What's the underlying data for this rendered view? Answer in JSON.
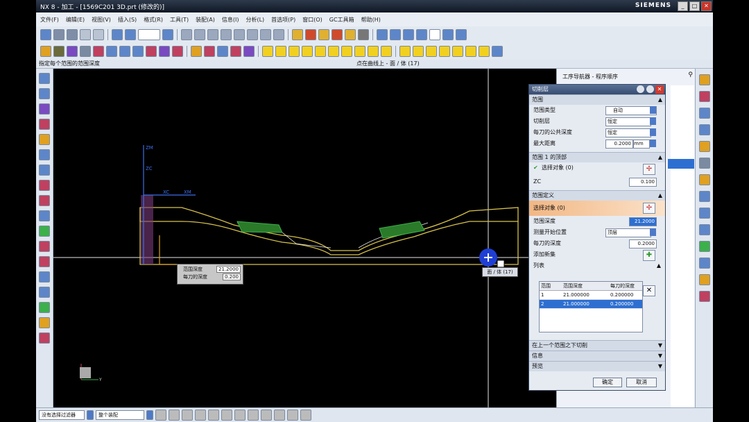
{
  "app": {
    "title": "NX 8 - 加工 - [1569C201 3D.prt (修改的)]",
    "brand": "SIEMENS"
  },
  "menu": [
    "文件(F)",
    "编辑(E)",
    "视图(V)",
    "插入(S)",
    "格式(R)",
    "工具(T)",
    "装配(A)",
    "信息(I)",
    "分析(L)",
    "首选项(P)",
    "窗口(O)",
    "GC工具箱",
    "帮助(H)"
  ],
  "hint": {
    "left": "指定每个范围的范围深度",
    "center": "点在曲线上 - 面 / 体 (17)"
  },
  "dialog": {
    "title": "切削层",
    "sec_main": "范围",
    "range_type_label": "范围类型",
    "range_type_value": "自动",
    "cut_layer_label": "切削层",
    "cut_layer_value": "恒定",
    "common_depth_label": "每刀的公共深度",
    "common_depth_value": "恒定",
    "max_dist_label": "最大距离",
    "max_dist_value": "0.2000",
    "max_dist_unit": "mm",
    "sec_range1": "范围 1 的顶部",
    "select_object_label": "选择对象 (0)",
    "zc_label": "ZC",
    "zc_value": "0.100",
    "sec_def": "范围定义",
    "select_object_label2": "选择对象 (0)",
    "range_depth_label": "范围深度",
    "range_depth_value": "21.2000",
    "measure_from_label": "测量开始位置",
    "measure_from_value": "顶层",
    "per_cut_depth_label": "每刀的深度",
    "per_cut_depth_value": "0.2000",
    "add_range_label": "添加新集",
    "list_label": "列表",
    "table_headers": [
      "范围",
      "范围深度",
      "每刀的深度"
    ],
    "table_rows": [
      [
        "1",
        "21.000000",
        "0.200000"
      ],
      [
        "2",
        "21.000000",
        "0.200000"
      ]
    ],
    "sec_between": "在上一个范围之下切削",
    "sec_preview": "信息",
    "sec_preview2": "预览",
    "ok": "确定",
    "cancel": "取消"
  },
  "navigator": {
    "title": "工序导航器 - 程序顺序"
  },
  "viewport_labels": {
    "zm": "ZM",
    "zc": "ZC",
    "xc": "XC",
    "xm": "XM",
    "xc2": "X",
    "yc": "Y"
  },
  "tooltip": {
    "depth_label": "范围深度",
    "depth_value": "21.2000",
    "per_cut_label": "每刀的深度",
    "per_cut_value": "0.200"
  },
  "snap_tip": "面 / 体 (17)",
  "status": {
    "filter1": "没有选择过滤器",
    "filter2": "整个装配"
  },
  "colors": {
    "viewport_bg": "#000000",
    "part_outline": "#d8c24a",
    "tool_path": "#3cb04a",
    "axis": "#3d6ee8",
    "mcs": "#e0a020",
    "cursor": "#1f3fd4",
    "hot": "#ee8844"
  }
}
